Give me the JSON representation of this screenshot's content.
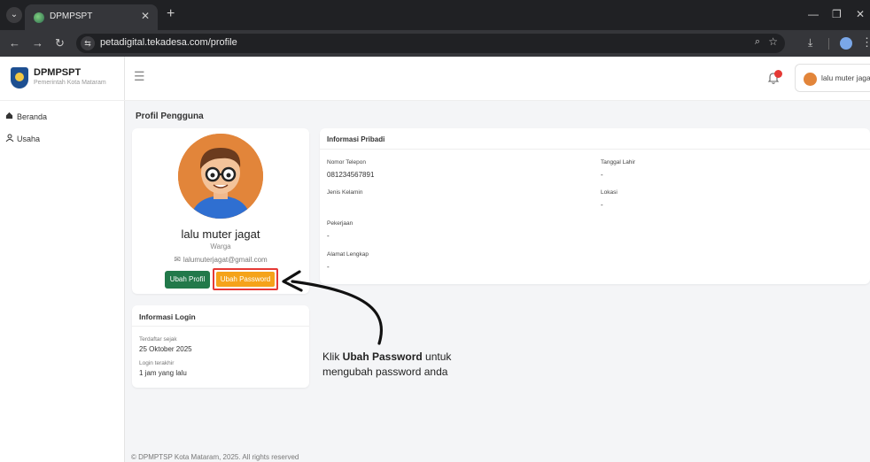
{
  "browser": {
    "tab_title": "DPMPSPT",
    "url": "petadigital.tekadesa.com/profile"
  },
  "sidebar": {
    "brand_name": "DPMPSPT",
    "brand_sub": "Pemerintah Kota Mataram",
    "items": [
      {
        "label": "Beranda",
        "icon": "home-icon"
      },
      {
        "label": "Usaha",
        "icon": "users-icon"
      }
    ]
  },
  "header": {
    "notification_color": "#e53935",
    "user_name": "lalu muter jagat"
  },
  "page": {
    "title": "Profil Pengguna"
  },
  "profile": {
    "name": "lalu muter jagat",
    "role": "Warga",
    "email": "lalumuterjagat@gmail.com",
    "edit_button": "Ubah Profil",
    "password_button": "Ubah Password"
  },
  "login_info": {
    "title": "Informasi Login",
    "registered_label": "Terdaftar sejak",
    "registered_value": "25 Oktober 2025",
    "last_login_label": "Login terakhir",
    "last_login_value": "1 jam yang lalu"
  },
  "personal_info": {
    "title": "Informasi Pribadi",
    "phone_label": "Nomor Telepon",
    "phone_value": "081234567891",
    "birth_label": "Tanggal Lahir",
    "birth_value": "-",
    "gender_label": "Jenis Kelamin",
    "gender_value": "",
    "location_label": "Lokasi",
    "location_value": "-",
    "job_label": "Pekerjaan",
    "job_value": "-",
    "address_label": "Alamat Lengkap",
    "address_value": "-"
  },
  "annotation": {
    "prefix": "Klik ",
    "bold": "Ubah Password",
    "suffix": " untuk",
    "line2": "mengubah password anda"
  },
  "footer": {
    "text": "© DPMPTSP Kota Mataram, 2025. All rights reserved"
  },
  "colors": {
    "primary_green": "#22794a",
    "warning_orange": "#f5a31a",
    "highlight_red": "#e53935"
  }
}
